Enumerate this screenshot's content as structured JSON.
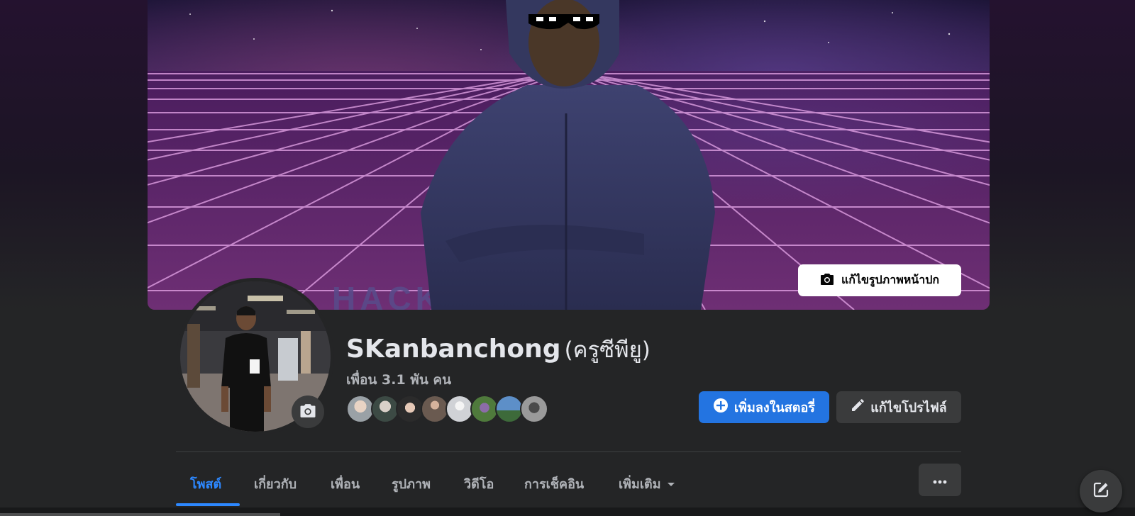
{
  "cover": {
    "edit_label": "แก้ไขรูปภาพหน้าปก",
    "text_overlay": "HACKERMAN"
  },
  "profile": {
    "name": "SKanbanchong",
    "alt_name": "(ครูซีพียู)",
    "friends_label": "เพื่อน 3.1 พัน คน"
  },
  "actions": {
    "add_story": "เพิ่มลงในสตอรี่",
    "edit_profile": "แก้ไขโปรไฟล์"
  },
  "tabs": [
    {
      "label": "โพสต์",
      "active": true
    },
    {
      "label": "เกี่ยวกับ"
    },
    {
      "label": "เพื่อน"
    },
    {
      "label": "รูปภาพ"
    },
    {
      "label": "วิดีโอ"
    },
    {
      "label": "การเช็คอิน"
    },
    {
      "label": "เพิ่มเติม"
    }
  ],
  "colors": {
    "background": "#242526",
    "accent": "#2374e1",
    "active_tab": "#2d88ff",
    "secondary_button": "#3a3b3c"
  },
  "icons": {
    "cover_edit": "camera-icon",
    "avatar_edit": "camera-icon",
    "add_story": "plus-circle-icon",
    "edit_profile": "pencil-icon",
    "more_tab": "caret-down-icon",
    "more_options": "ellipsis-icon",
    "compose": "compose-icon"
  }
}
